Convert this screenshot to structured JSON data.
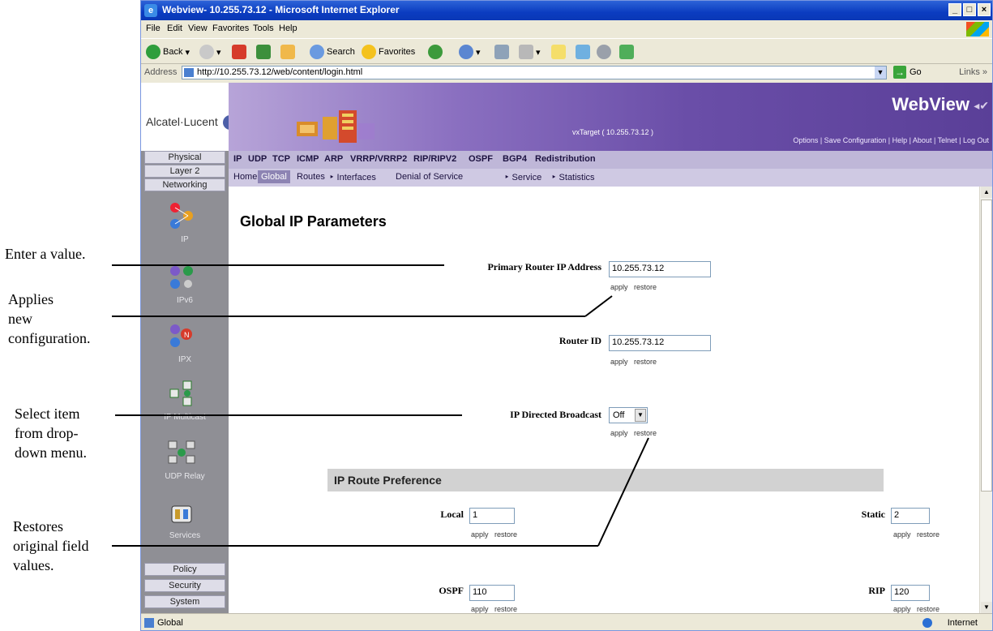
{
  "annotations": {
    "enter_value": "Enter a value.",
    "applies": [
      "Applies",
      "new",
      "configuration."
    ],
    "select_item": [
      "Select item",
      "from drop-",
      "down menu."
    ],
    "restores": [
      "Restores",
      "original field",
      "values."
    ]
  },
  "browser": {
    "title": "Webview- 10.255.73.12 - Microsoft Internet Explorer",
    "menu": [
      "File",
      "Edit",
      "View",
      "Favorites",
      "Tools",
      "Help"
    ],
    "back_label": "Back",
    "search_label": "Search",
    "favorites_label": "Favorites",
    "address_label": "Address",
    "url": "http://10.255.73.12/web/content/login.html",
    "go_label": "Go",
    "links_label": "Links »",
    "status_text": "Global",
    "zone_text": "Internet"
  },
  "app": {
    "logo": "Alcatel·Lucent",
    "target": "vxTarget  ( 10.255.73.12 )",
    "brand": "WebView",
    "toplinks": "Options  |  Save Configuration  |  Help  |  About  |  Telnet  |  Log Out",
    "tabs": [
      "IP",
      "UDP",
      "TCP",
      "ICMP",
      "ARP",
      "VRRP/VRRP2",
      "RIP/RIPV2",
      "OSPF",
      "BGP4",
      "Redistribution"
    ],
    "subtabs": [
      "Home",
      "Global",
      "Routes",
      "‣ Interfaces",
      "Denial of Service",
      "‣ Service",
      "‣ Statistics"
    ],
    "sidebar": {
      "buttons_top": [
        "Physical",
        "Layer 2",
        "Networking"
      ],
      "items": [
        "IP",
        "IPv6",
        "IPX",
        "IP Multicast",
        "UDP Relay",
        "Services"
      ],
      "buttons_bottom": [
        "Policy",
        "Security",
        "System"
      ]
    }
  },
  "content": {
    "title": "Global IP Parameters",
    "apply": "apply",
    "restore": "restore",
    "primary_router_label": "Primary Router IP Address",
    "primary_router_value": "10.255.73.12",
    "router_id_label": "Router ID",
    "router_id_value": "10.255.73.12",
    "broadcast_label": "IP Directed Broadcast",
    "broadcast_value": "Off",
    "section_title": "IP Route Preference",
    "local_label": "Local",
    "local_value": "1",
    "static_label": "Static",
    "static_value": "2",
    "ospf_label": "OSPF",
    "ospf_value": "110",
    "rip_label": "RIP",
    "rip_value": "120"
  }
}
